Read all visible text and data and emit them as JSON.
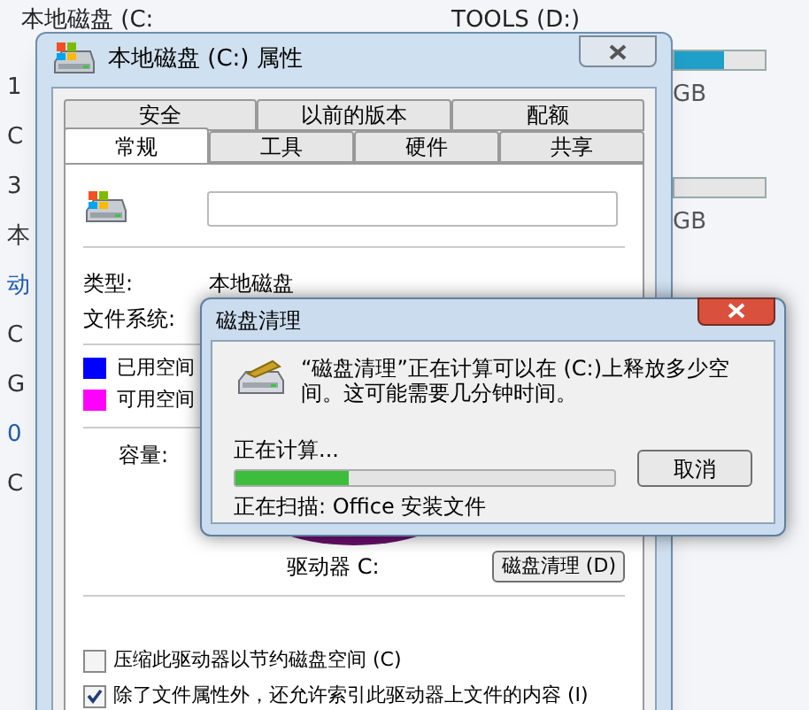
{
  "explorer": {
    "top_labels": [
      "本地磁盘 (C:",
      "TOOLS (D:)"
    ],
    "left_fragments": [
      {
        "text": "1",
        "kind": "plain"
      },
      {
        "text": "C",
        "kind": "plain"
      },
      {
        "text": "3",
        "kind": "plain"
      },
      {
        "text": "本",
        "kind": "plain"
      },
      {
        "text": "动",
        "kind": "link"
      },
      {
        "text": "C",
        "kind": "plain"
      },
      {
        "text": "G",
        "kind": "plain"
      },
      {
        "text": "0",
        "kind": "link"
      },
      {
        "text": "C",
        "kind": "plain"
      }
    ],
    "right_drives": [
      {
        "level": 0.55,
        "size": "GB"
      },
      {
        "size": "GB"
      }
    ]
  },
  "properties": {
    "title": "本地磁盘 (C:) 属性",
    "tab_rows": [
      [
        {
          "label": "安全",
          "selected": false
        },
        {
          "label": "以前的版本",
          "selected": false
        },
        {
          "label": "配额",
          "selected": false
        }
      ],
      [
        {
          "label": "常规",
          "selected": true
        },
        {
          "label": "工具",
          "selected": false
        },
        {
          "label": "硬件",
          "selected": false
        },
        {
          "label": "共享",
          "selected": false
        }
      ]
    ],
    "fields": [
      {
        "label": "类型:",
        "value": "本地磁盘"
      },
      {
        "label": "文件系统:"
      }
    ],
    "legend": [
      {
        "label": "已用空间",
        "color": "#0000ff"
      },
      {
        "label": "可用空间",
        "color": "#ff00ff"
      }
    ],
    "capacity_label": "容量:",
    "drive_label": "驱动器 C:",
    "cleanup_button": "磁盘清理 (D)",
    "options": [
      {
        "label": "压缩此驱动器以节约磁盘空间 (C)",
        "checked": false
      },
      {
        "label": "除了文件属性外，还允许索引此驱动器上文件的内容 (I)",
        "checked": true
      }
    ]
  },
  "cleanup_dialog": {
    "title": "磁盘清理",
    "message": "“磁盘清理”正在计算可以在 (C:)上释放多少空间。这可能需要几分钟时间。",
    "status": "正在计算...",
    "progress": {
      "level": 0.3
    },
    "cancel_button": "取消",
    "scanning": "正在扫描: Office 安装文件"
  }
}
